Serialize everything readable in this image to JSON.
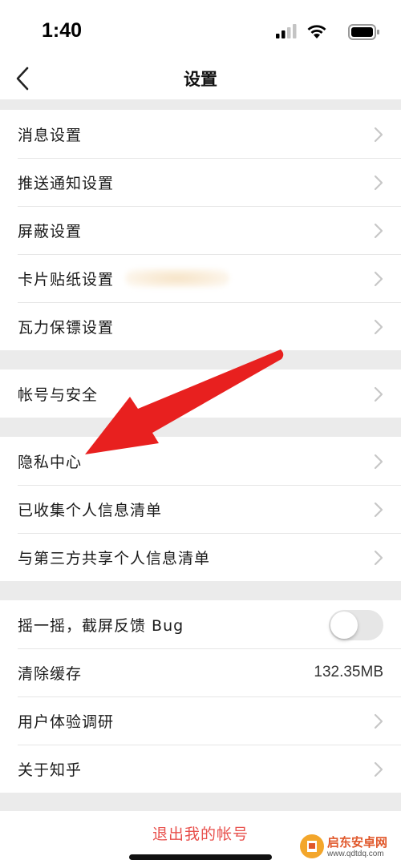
{
  "status_bar": {
    "time": "1:40"
  },
  "nav": {
    "title": "设置"
  },
  "section1": [
    {
      "label": "消息设置"
    },
    {
      "label": "推送通知设置"
    },
    {
      "label": "屏蔽设置"
    },
    {
      "label": "卡片贴纸设置"
    },
    {
      "label": "瓦力保镖设置"
    }
  ],
  "section2": [
    {
      "label": "帐号与安全"
    }
  ],
  "section3": [
    {
      "label": "隐私中心"
    },
    {
      "label": "已收集个人信息清单"
    },
    {
      "label": "与第三方共享个人信息清单"
    }
  ],
  "section4": {
    "shake_label": "摇一摇，截屏反馈 Bug",
    "shake_toggle_on": false,
    "clear_cache_label": "清除缓存",
    "clear_cache_value": "132.35MB",
    "survey_label": "用户体验调研",
    "about_label": "关于知乎"
  },
  "logout": {
    "label": "退出我的帐号"
  },
  "watermark": {
    "text": "启东安卓网",
    "url": "www.qdtdq.com"
  },
  "colors": {
    "logout": "#e8514d",
    "annotation_arrow": "#e8201f",
    "background": "#ebebeb"
  }
}
